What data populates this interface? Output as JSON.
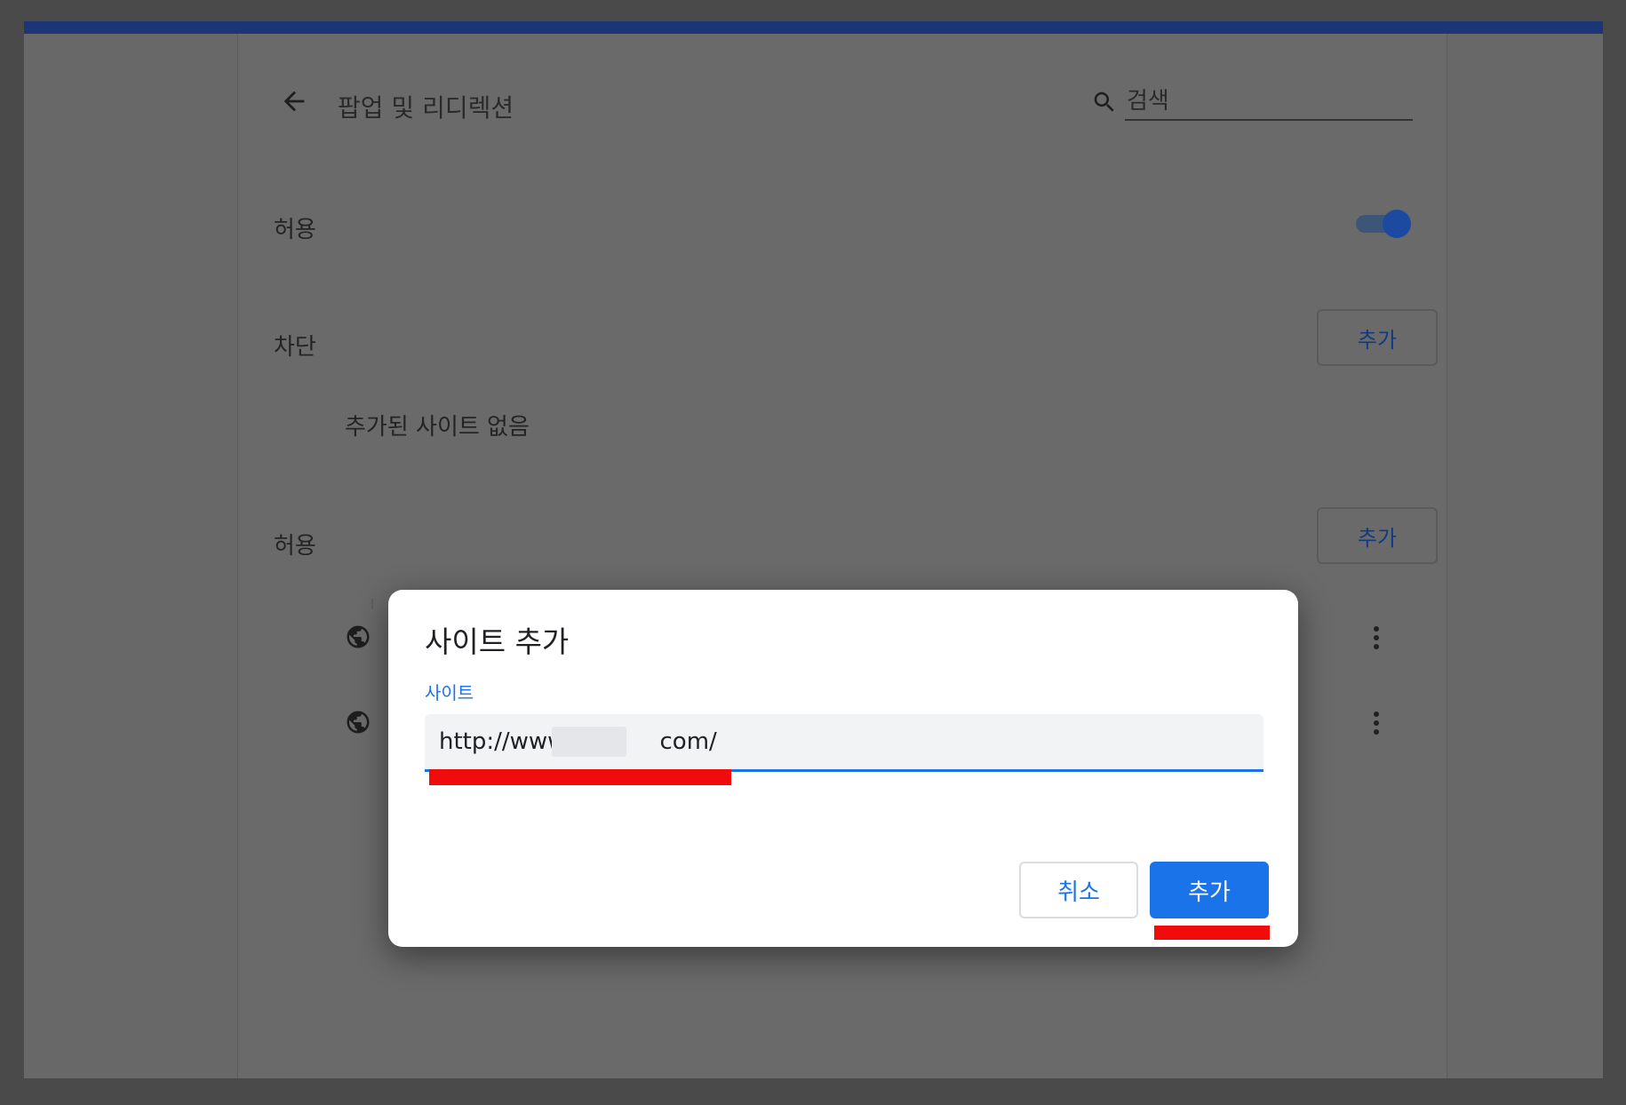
{
  "header": {
    "title": "팝업 및 리디렉션",
    "search_placeholder": "검색"
  },
  "settings": {
    "allowed_toggle_label": "허용",
    "allowed_toggle_on": true,
    "blocked_section": {
      "label": "차단",
      "add_label": "추가",
      "empty_text": "추가된 사이트 없음"
    },
    "allowed_section": {
      "label": "허용",
      "add_label": "추가"
    }
  },
  "dialog": {
    "title": "사이트 추가",
    "field_label": "사이트",
    "field_value": "http://www.            com/",
    "cancel_label": "취소",
    "add_label": "추가"
  },
  "colors": {
    "accent": "#1a73e8",
    "annotation": "#f00c0c",
    "top_bar": "#1c3577"
  }
}
